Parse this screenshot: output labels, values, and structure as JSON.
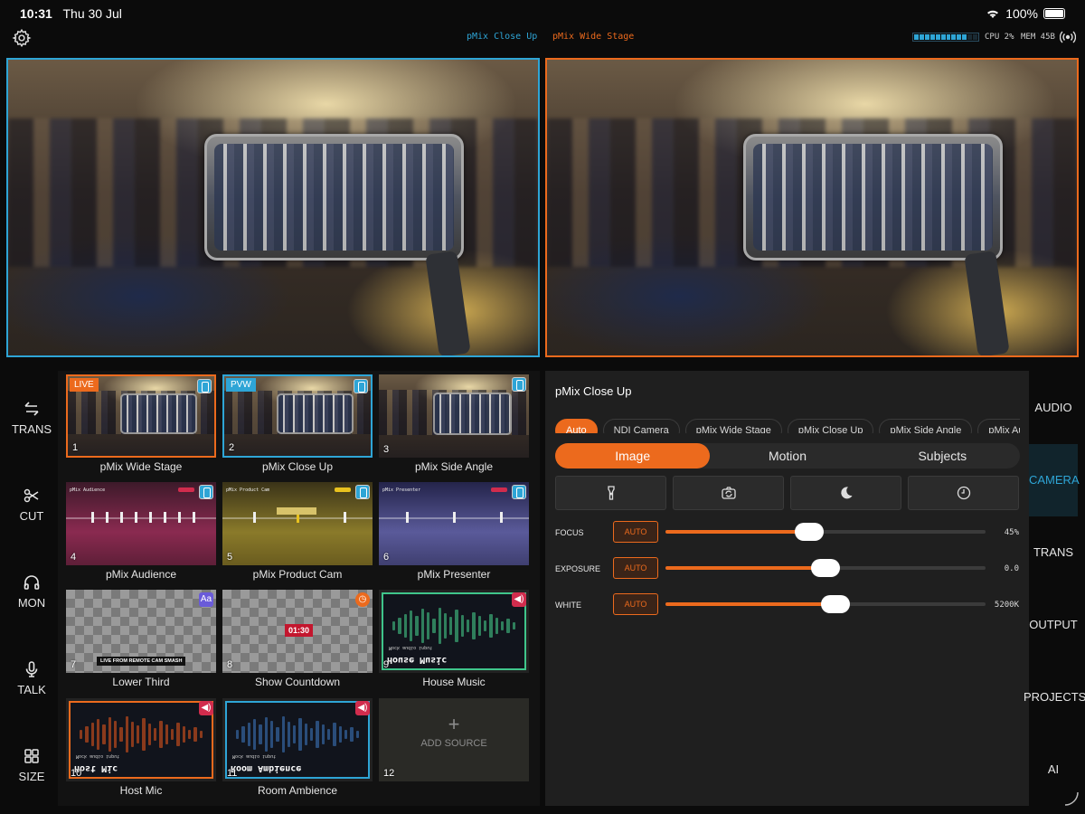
{
  "status": {
    "time": "10:31",
    "date": "Thu 30 Jul",
    "battery": "100%"
  },
  "topbar": {
    "preview_label": "pMix Close Up",
    "program_label": "pMix Wide Stage",
    "cpu": "CPU 2%",
    "mem": "MEM 45B",
    "meter_level": 0.82
  },
  "left_rail": [
    {
      "label": "TRANS",
      "icon": "transition-arrows-icon"
    },
    {
      "label": "CUT",
      "icon": "scissors-icon"
    },
    {
      "label": "MON",
      "icon": "headphones-icon"
    },
    {
      "label": "TALK",
      "icon": "microphone-icon"
    },
    {
      "label": "SIZE",
      "icon": "grid-icon"
    }
  ],
  "sources": [
    {
      "num": "1",
      "name": "pMix Wide Stage",
      "badge": "LIVE",
      "kind": "camera"
    },
    {
      "num": "2",
      "name": "pMix Close Up",
      "badge": "PVW",
      "kind": "camera"
    },
    {
      "num": "3",
      "name": "pMix Side Angle",
      "badge": "",
      "kind": "camera"
    },
    {
      "num": "4",
      "name": "pMix Audience",
      "kind": "stage",
      "thumb_title": "pMix Audience"
    },
    {
      "num": "5",
      "name": "pMix Product Cam",
      "kind": "stage",
      "thumb_title": "pMix Product Cam"
    },
    {
      "num": "6",
      "name": "pMix Presenter",
      "kind": "stage",
      "thumb_title": "pMix Presenter"
    },
    {
      "num": "7",
      "name": "Lower Third",
      "kind": "lower-third",
      "overlay_text": "LIVE FROM REMOTE CAM SMASH",
      "icon_text": "Aa"
    },
    {
      "num": "8",
      "name": "Show Countdown",
      "kind": "countdown",
      "overlay_text": "01:30"
    },
    {
      "num": "9",
      "name": "House Music",
      "kind": "audio",
      "caption": "House Music",
      "sub": "Mock audio input"
    },
    {
      "num": "10",
      "name": "Host Mic",
      "kind": "audio",
      "caption": "Host Mic",
      "sub": "Mock audio input"
    },
    {
      "num": "11",
      "name": "Room Ambience",
      "kind": "audio",
      "caption": "Room Ambience",
      "sub": "Mock audio input"
    },
    {
      "num": "12",
      "add_label": "ADD SOURCE",
      "kind": "add"
    }
  ],
  "camera_panel": {
    "title": "pMix Close Up",
    "camera_tabs": [
      "Auto",
      "NDI Camera",
      "pMix Wide Stage",
      "pMix Close Up",
      "pMix Side Angle",
      "pMix Audience"
    ],
    "active_camera_tab": "Auto",
    "segments": [
      "Image",
      "Motion",
      "Subjects"
    ],
    "active_segment": "Image",
    "tools": [
      "flashlight-icon",
      "camera-flip-icon",
      "night-mode-icon",
      "timer-icon"
    ],
    "sliders": [
      {
        "label": "FOCUS",
        "auto": "AUTO",
        "value": "45%",
        "level": 0.45
      },
      {
        "label": "EXPOSURE",
        "auto": "AUTO",
        "value": "0.0",
        "level": 0.5
      },
      {
        "label": "WHITE",
        "auto": "AUTO",
        "value": "5200K",
        "level": 0.53
      }
    ]
  },
  "right_rail": [
    "AUDIO",
    "CAMERA",
    "TRANS",
    "OUTPUT",
    "PROJECTS",
    "AI"
  ],
  "active_right_tab": "CAMERA",
  "colors": {
    "accent": "#ec6a1d",
    "preview": "#2ea5d6",
    "live": "#ec6a1d",
    "panel": "#1f1f1f"
  }
}
